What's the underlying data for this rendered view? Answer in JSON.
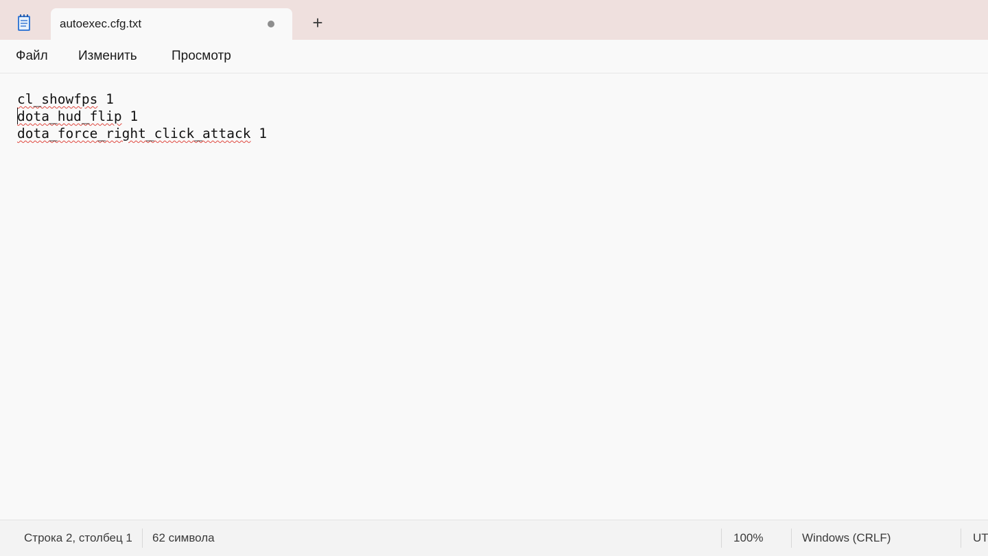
{
  "tab": {
    "title": "autoexec.cfg.txt",
    "unsaved_icon": "dot-icon",
    "new_tab_label": "+"
  },
  "app_icon": "notepad-icon",
  "menu": {
    "items": [
      {
        "label": "Файл"
      },
      {
        "label": "Изменить"
      },
      {
        "label": "Просмотр"
      }
    ]
  },
  "editor": {
    "lines": [
      {
        "word": "cl_showfps",
        "value": " 1"
      },
      {
        "word": "dota_hud_flip",
        "value": " 1"
      },
      {
        "word": "dota_force_right_click_attack",
        "value": " 1"
      }
    ],
    "spellcheck_color": "#e0453c"
  },
  "status": {
    "position": "Строка 2, столбец 1",
    "chars": "62 символа",
    "zoom": "100%",
    "line_ending": "Windows (CRLF)",
    "encoding": "UT"
  }
}
